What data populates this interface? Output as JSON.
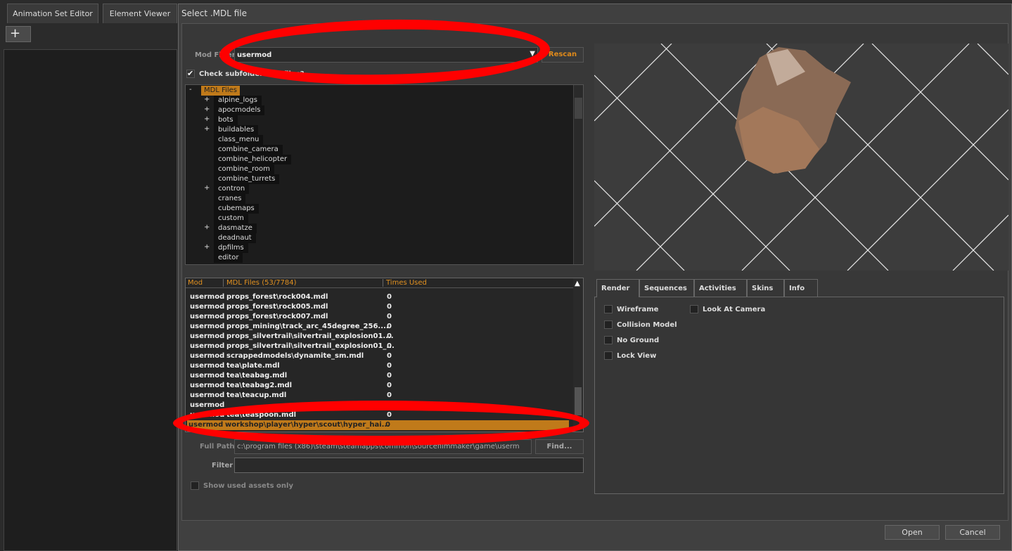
{
  "app": {
    "tabs": [
      "Animation Set Editor",
      "Element Viewer"
    ],
    "add_label": "+"
  },
  "dialog": {
    "title": "Select .MDL file",
    "mod_filter_label": "Mod Filter",
    "mod_filter_value": "usermod",
    "rescan_label": "Rescan",
    "check_subfolders_label": "Check subfolders for files?",
    "check_subfolders_checked": true,
    "tree": {
      "root": "MDL Files",
      "items": [
        {
          "label": "alpine_logs",
          "expand": "+"
        },
        {
          "label": "apocmodels",
          "expand": "+"
        },
        {
          "label": "bots",
          "expand": "+"
        },
        {
          "label": "buildables",
          "expand": "+"
        },
        {
          "label": "class_menu",
          "expand": ""
        },
        {
          "label": "combine_camera",
          "expand": ""
        },
        {
          "label": "combine_helicopter",
          "expand": ""
        },
        {
          "label": "combine_room",
          "expand": ""
        },
        {
          "label": "combine_turrets",
          "expand": ""
        },
        {
          "label": "contron",
          "expand": "+"
        },
        {
          "label": "cranes",
          "expand": ""
        },
        {
          "label": "cubemaps",
          "expand": ""
        },
        {
          "label": "custom",
          "expand": ""
        },
        {
          "label": "dasmatze",
          "expand": "+"
        },
        {
          "label": "deadnaut",
          "expand": ""
        },
        {
          "label": "dpfilms",
          "expand": "+"
        },
        {
          "label": "editor",
          "expand": ""
        }
      ]
    },
    "list": {
      "headers": [
        "Mod",
        "MDL Files (53/7784)",
        "Times Used"
      ],
      "rows": [
        [
          "usermod",
          "props_forest\\rock004.mdl",
          "0"
        ],
        [
          "usermod",
          "props_forest\\rock005.mdl",
          "0"
        ],
        [
          "usermod",
          "props_forest\\rock007.mdl",
          "0"
        ],
        [
          "usermod",
          "props_mining\\track_arc_45degree_256....",
          "0"
        ],
        [
          "usermod",
          "props_silvertrail\\silvertrail_explosion01....",
          "0"
        ],
        [
          "usermod",
          "props_silvertrail\\silvertrail_explosion01_...",
          "0"
        ],
        [
          "usermod",
          "scrappedmodels\\dynamite_sm.mdl",
          "0"
        ],
        [
          "usermod",
          "tea\\plate.mdl",
          "0"
        ],
        [
          "usermod",
          "tea\\teabag.mdl",
          "0"
        ],
        [
          "usermod",
          "tea\\teabag2.mdl",
          "0"
        ],
        [
          "usermod",
          "tea\\teacup.mdl",
          "0"
        ],
        [
          "usermod",
          "",
          "0"
        ],
        [
          "usermod",
          "tea\\teaspoon.mdl",
          "0"
        ],
        [
          "usermod",
          "workshop\\player\\hyper\\scout\\hyper_hai...",
          "0"
        ]
      ],
      "selected_index": 13
    },
    "full_path_label": "Full Path",
    "full_path_value": "c:\\program files (x86)\\steam\\steamapps\\common\\sourcefilmmaker\\game\\userm",
    "find_label": "Find...",
    "filter_label": "Filter",
    "filter_value": "",
    "show_used_label": "Show used assets only",
    "render_tabs": [
      "Render",
      "Sequences",
      "Activities",
      "Skins",
      "Info"
    ],
    "render_options": [
      "Wireframe",
      "Collision Model",
      "No Ground",
      "Lock View",
      "Look At Camera"
    ],
    "open_label": "Open",
    "cancel_label": "Cancel"
  },
  "colors": {
    "accent": "#c07a1a",
    "annotation": "#ff0000"
  }
}
